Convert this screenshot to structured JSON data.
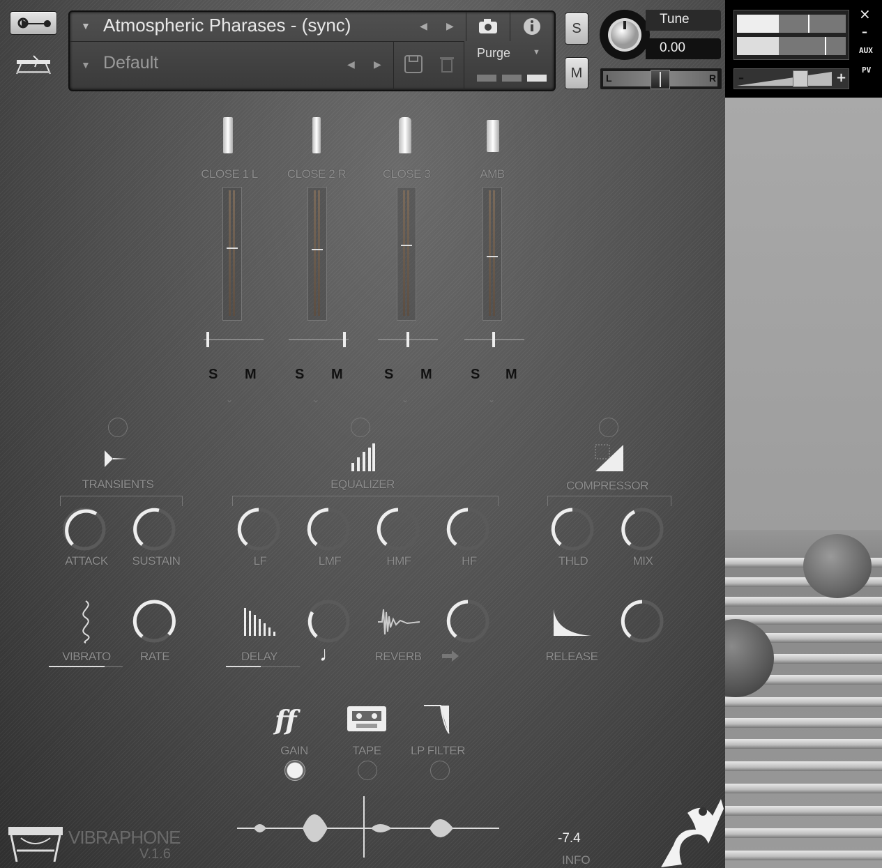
{
  "header": {
    "instrument_name": "Atmospheric Pharases - (sync)",
    "snapshot_name": "Default",
    "purge_label": "Purge",
    "tune_label": "Tune",
    "tune_value": "0.00",
    "solo_label": "S",
    "mute_label": "M",
    "pan_left": "L",
    "pan_right": "R"
  },
  "side_panel": {
    "aux_label": "AUX",
    "pv_label": "PV",
    "close_label": "×",
    "minimize_label": "–",
    "minus_label": "–",
    "plus_label": "+"
  },
  "mixer": {
    "channels": [
      {
        "label": "CLOSE 1 L",
        "solo": "S",
        "mute": "M"
      },
      {
        "label": "CLOSE 2 R",
        "solo": "S",
        "mute": "M"
      },
      {
        "label": "CLOSE 3",
        "solo": "S",
        "mute": "M"
      },
      {
        "label": "AMB",
        "solo": "S",
        "mute": "M"
      }
    ]
  },
  "effects": {
    "transients": {
      "label": "TRANSIENTS",
      "knobs": [
        "ATTACK",
        "SUSTAIN"
      ]
    },
    "equalizer": {
      "label": "EQUALIZER",
      "knobs": [
        "LF",
        "LMF",
        "HMF",
        "HF"
      ]
    },
    "compressor": {
      "label": "COMPRESSOR",
      "knobs": [
        "THLD",
        "MIX"
      ]
    }
  },
  "modulation": {
    "vibrato": "VIBRATO",
    "rate": "RATE",
    "delay": "DELAY",
    "reverb": "REVERB",
    "release": "RELEASE"
  },
  "bottom": {
    "gain": "GAIN",
    "tape": "TAPE",
    "lp_filter": "LP FILTER",
    "product_name": "VIBRAPHONE",
    "version": "V.1.6",
    "level_value": "-7.4",
    "info_label": "INFO"
  },
  "colors": {
    "panel_bg": "#4c4c4c",
    "label_gray": "#8e8e8e",
    "knob_arc": "#e6e6e6"
  }
}
